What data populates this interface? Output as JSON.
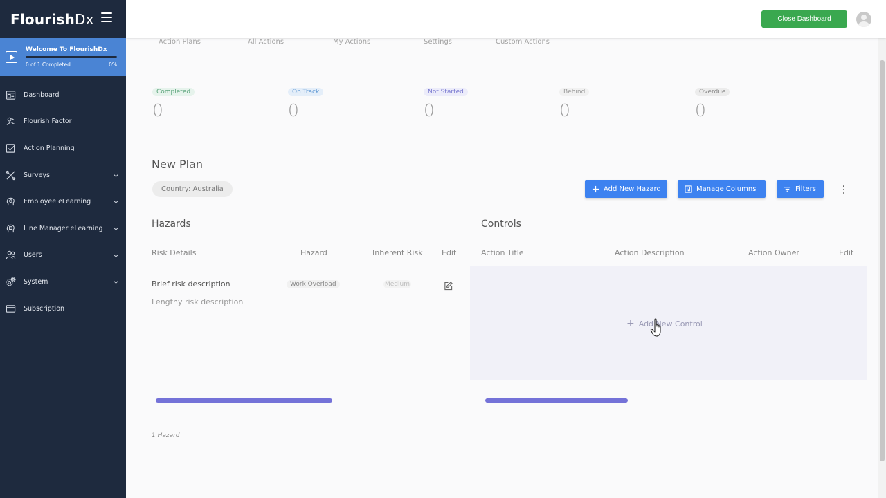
{
  "brand": {
    "logo_bold": "Flourish",
    "logo_light": "Dx"
  },
  "welcome": {
    "title": "Welcome To FlourishDx",
    "progress_text": "0 of 1 Completed",
    "percent": "0%",
    "progress_fraction": 0
  },
  "sidebar": {
    "items": [
      {
        "label": "Dashboard",
        "icon": "dashboard-icon",
        "expandable": false
      },
      {
        "label": "Flourish Factor",
        "icon": "flourish-factor-icon",
        "expandable": false
      },
      {
        "label": "Action Planning",
        "icon": "checkbox-icon",
        "expandable": false
      },
      {
        "label": "Surveys",
        "icon": "surveys-icon",
        "expandable": true
      },
      {
        "label": "Employee eLearning",
        "icon": "lightbulb-head-icon",
        "expandable": true
      },
      {
        "label": "Line Manager eLearning",
        "icon": "manager-head-icon",
        "expandable": true
      },
      {
        "label": "Users",
        "icon": "users-icon",
        "expandable": true
      },
      {
        "label": "System",
        "icon": "system-gear-icon",
        "expandable": true
      },
      {
        "label": "Subscription",
        "icon": "credit-card-icon",
        "expandable": false
      }
    ]
  },
  "header": {
    "close_label": "Close Dashboard"
  },
  "tabs": [
    "Action Plans",
    "All Actions",
    "My Actions",
    "Settings",
    "Custom Actions"
  ],
  "stats": [
    {
      "label": "Completed",
      "value": "0",
      "color": "#5aa37a",
      "bg": "#e6f3ec"
    },
    {
      "label": "On Track",
      "value": "0",
      "color": "#5b95d2",
      "bg": "#e4eef9"
    },
    {
      "label": "Not Started",
      "value": "0",
      "color": "#7a7ad0",
      "bg": "#ececfa"
    },
    {
      "label": "Behind",
      "value": "0",
      "color": "#9a9a9a",
      "bg": "#f1f1f1"
    },
    {
      "label": "Overdue",
      "value": "0",
      "color": "#8a8a8a",
      "bg": "#ececec"
    }
  ],
  "plan": {
    "title": "New Plan",
    "country_chip": "Country: Australia"
  },
  "buttons": {
    "add_hazard": "Add New Hazard",
    "manage_columns": "Manage Columns",
    "filters": "Filters"
  },
  "hazards": {
    "title": "Hazards",
    "columns": [
      "Risk Details",
      "Hazard",
      "Inherent Risk",
      "Edit"
    ],
    "row": {
      "brief": "Brief risk description",
      "lengthy": "Lengthy risk description",
      "hazard": "Work Overload",
      "risk": "Medium"
    },
    "count_text": "1 Hazard"
  },
  "controls": {
    "title": "Controls",
    "columns": [
      "Action Title",
      "Action Description",
      "Action Owner",
      "Edit"
    ],
    "add_label": "Add New Control"
  },
  "colors": {
    "sidebar_bg": "#1e2a3e",
    "accent": "#3d82f0",
    "success": "#3aa84f",
    "welcome_bg": "#4a84d4",
    "progress": "#7472d8"
  }
}
